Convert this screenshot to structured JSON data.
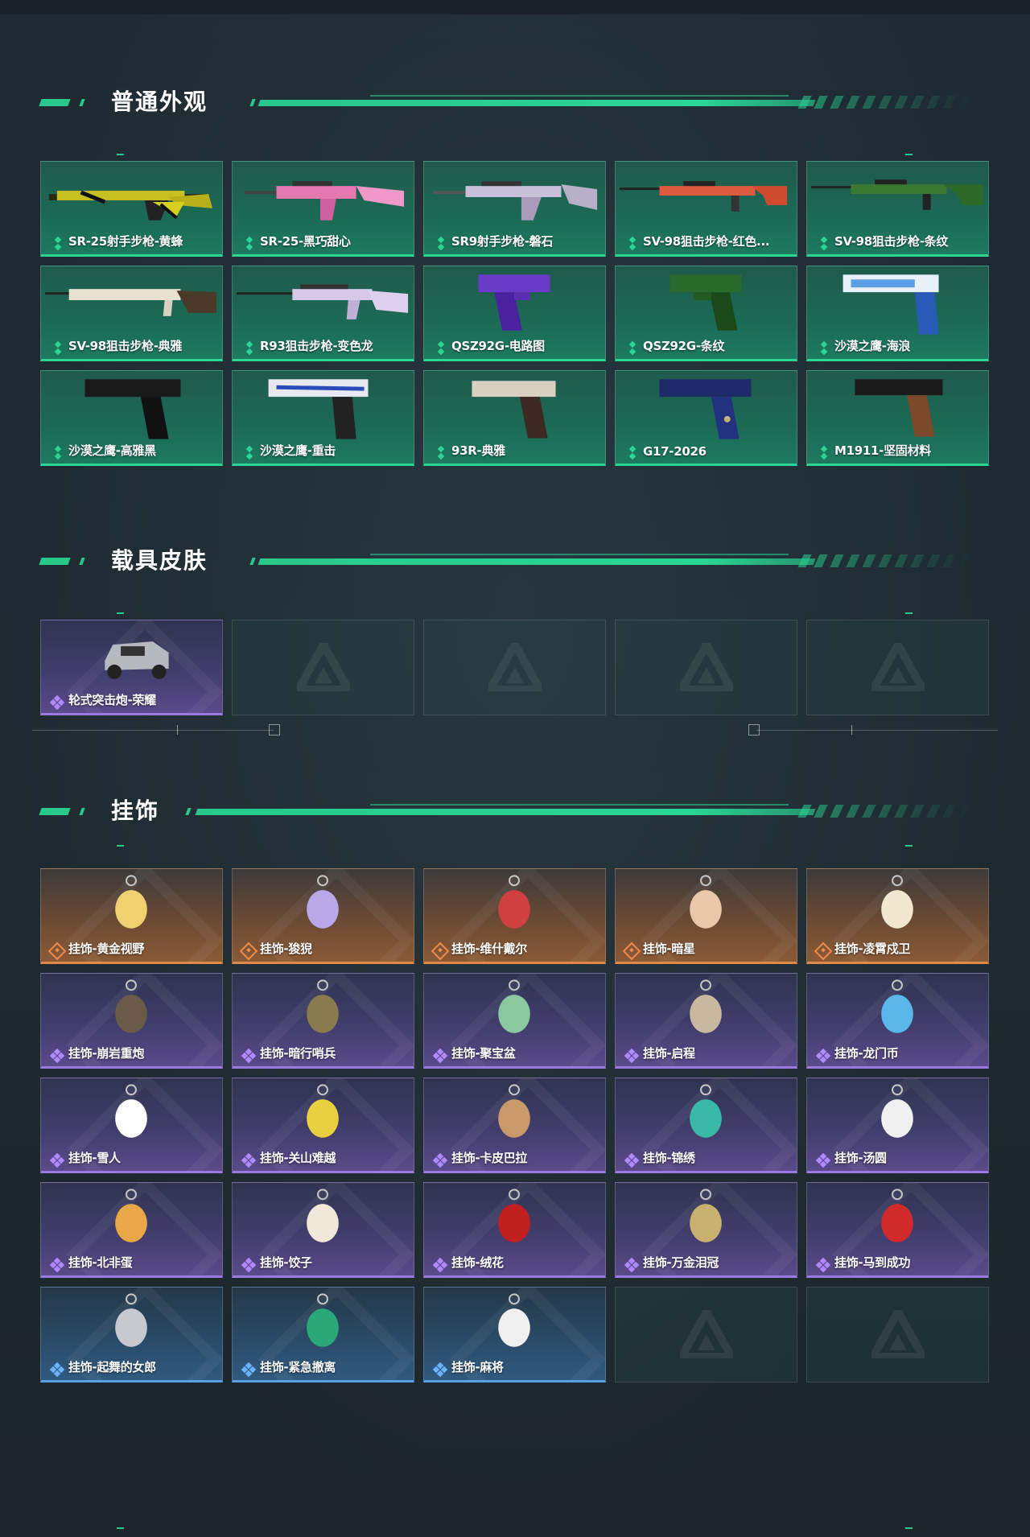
{
  "sections": {
    "normal": {
      "title": "普通外观",
      "items": [
        {
          "label": "SR-25射手步枪-黄蜂"
        },
        {
          "label": "SR-25-黑巧甜心"
        },
        {
          "label": "SR9射手步枪-磐石"
        },
        {
          "label": "SV-98狙击步枪-红色..."
        },
        {
          "label": "SV-98狙击步枪-条纹"
        },
        {
          "label": "SV-98狙击步枪-典雅"
        },
        {
          "label": "R93狙击步枪-变色龙"
        },
        {
          "label": "QSZ92G-电路图"
        },
        {
          "label": "QSZ92G-条纹"
        },
        {
          "label": "沙漠之鹰-海浪"
        },
        {
          "label": "沙漠之鹰-高雅黑"
        },
        {
          "label": "沙漠之鹰-重击"
        },
        {
          "label": "93R-典雅"
        },
        {
          "label": "G17-2026"
        },
        {
          "label": "M1911-坚固材料"
        }
      ]
    },
    "vehicle": {
      "title": "载具皮肤",
      "items": [
        {
          "label": "轮式突击炮-荣耀"
        }
      ]
    },
    "charms": {
      "title": "挂饰",
      "items": [
        {
          "label": "挂饰-黄金视野"
        },
        {
          "label": "挂饰-狻猊"
        },
        {
          "label": "挂饰-维什戴尔"
        },
        {
          "label": "挂饰-暗星"
        },
        {
          "label": "挂饰-凌霄戍卫"
        },
        {
          "label": "挂饰-崩岩重炮"
        },
        {
          "label": "挂饰-暗行哨兵"
        },
        {
          "label": "挂饰-聚宝盆"
        },
        {
          "label": "挂饰-启程"
        },
        {
          "label": "挂饰-龙门币"
        },
        {
          "label": "挂饰-雪人"
        },
        {
          "label": "挂饰-关山难越"
        },
        {
          "label": "挂饰-卡皮巴拉"
        },
        {
          "label": "挂饰-锦绣"
        },
        {
          "label": "挂饰-汤圆"
        },
        {
          "label": "挂饰-北非蛋"
        },
        {
          "label": "挂饰-饺子"
        },
        {
          "label": "挂饰-绒花"
        },
        {
          "label": "挂饰-万金泪冠"
        },
        {
          "label": "挂饰-马到成功"
        },
        {
          "label": "挂饰-起舞的女郎"
        },
        {
          "label": "挂饰-紧急撤离"
        },
        {
          "label": "挂饰-麻将"
        }
      ]
    }
  },
  "colors": {
    "accent": "#2ad694",
    "rarity_green": "#2ad694",
    "rarity_purple": "#9a7ae0",
    "rarity_orange": "#e0884a",
    "rarity_blue": "#5aa0e8"
  },
  "icons": {
    "rarity_green": "double-diamond-icon",
    "rarity_purple": "four-diamond-icon",
    "rarity_orange": "diamond-outline-icon",
    "rarity_blue": "four-diamond-icon",
    "empty_slot": "delta-logo-icon"
  }
}
